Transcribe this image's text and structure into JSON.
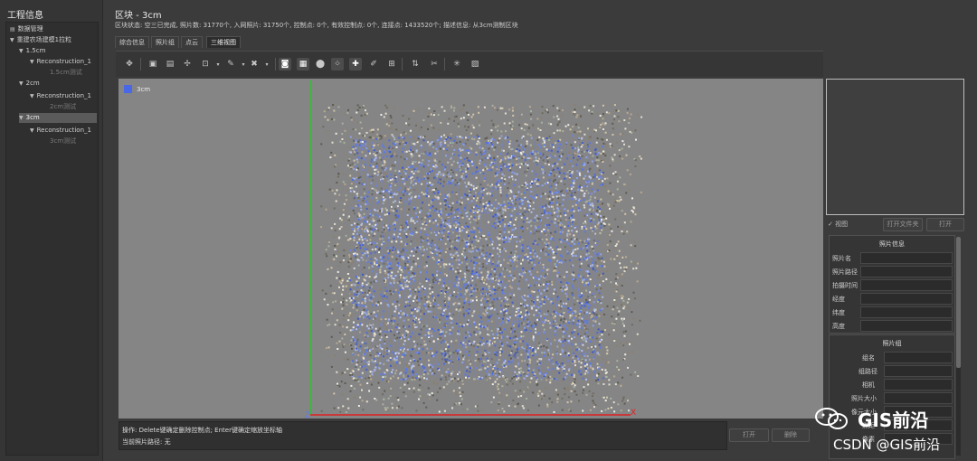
{
  "left_panel": {
    "title": "工程信息",
    "tree": [
      {
        "label": "数据管理",
        "icon": "database-icon"
      },
      {
        "label": "重建农场建模1拉粒"
      },
      {
        "label": "1.5cm"
      },
      {
        "label": "Reconstruction_1"
      },
      {
        "label": "1.5cm测试"
      },
      {
        "label": "2cm"
      },
      {
        "label": "Reconstruction_1"
      },
      {
        "label": "2cm测试"
      },
      {
        "label": "3cm"
      },
      {
        "label": "Reconstruction_1"
      },
      {
        "label": "3cm测试"
      }
    ]
  },
  "header": {
    "title": "区块 - 3cm",
    "status": "区块状态: 空三已完成, 照片数: 31770个, 入网照片: 31750个, 控制点: 0个, 有效控制点: 0个, 连接点: 1433520个; 描述信息: 从3cm测制区块"
  },
  "tabs": [
    "综合信息",
    "照片组",
    "点云",
    "三维视图"
  ],
  "active_tab": 3,
  "toolbar": {
    "tools": [
      "move-icon",
      "camera-group-icon",
      "camera-add-icon",
      "tie-point-icon",
      "frame-icon",
      "pin-icon",
      "tools-icon",
      "camera-icon",
      "photo-view-icon",
      "location-icon",
      "point-select-icon",
      "crosshair-icon",
      "brush-icon",
      "fit-icon",
      "swap-icon",
      "scissors-icon",
      "star-icon",
      "image-icon"
    ]
  },
  "viewport": {
    "block_label": "3cm",
    "block_color": "#4a67e6",
    "axis_x_color": "#e02020",
    "axis_y_color": "#30c030",
    "axis_z_label": "Z",
    "axis_x_label": "X"
  },
  "message": {
    "line1": "操作: Delete键确定删除控制点; Enter键确定缩放坐标轴",
    "line2": "当前照片路径: 无",
    "btn1": "打开",
    "btn2": "删除"
  },
  "right_panel": {
    "check_label": "视图",
    "btn_open_folder": "打开文件夹",
    "btn_open": "打开",
    "photo_info": {
      "title": "照片信息",
      "fields": [
        "照片名",
        "照片路径",
        "拍摄时间",
        "经度",
        "纬度",
        "高度"
      ]
    },
    "photo_group": {
      "title": "照片组",
      "fields": [
        "组名",
        "组路径",
        "相机",
        "照片大小",
        "像元大小",
        "焦距",
        "像素"
      ]
    }
  },
  "watermark": {
    "brand": "GIS前沿",
    "source": "CSDN @GIS前沿"
  }
}
